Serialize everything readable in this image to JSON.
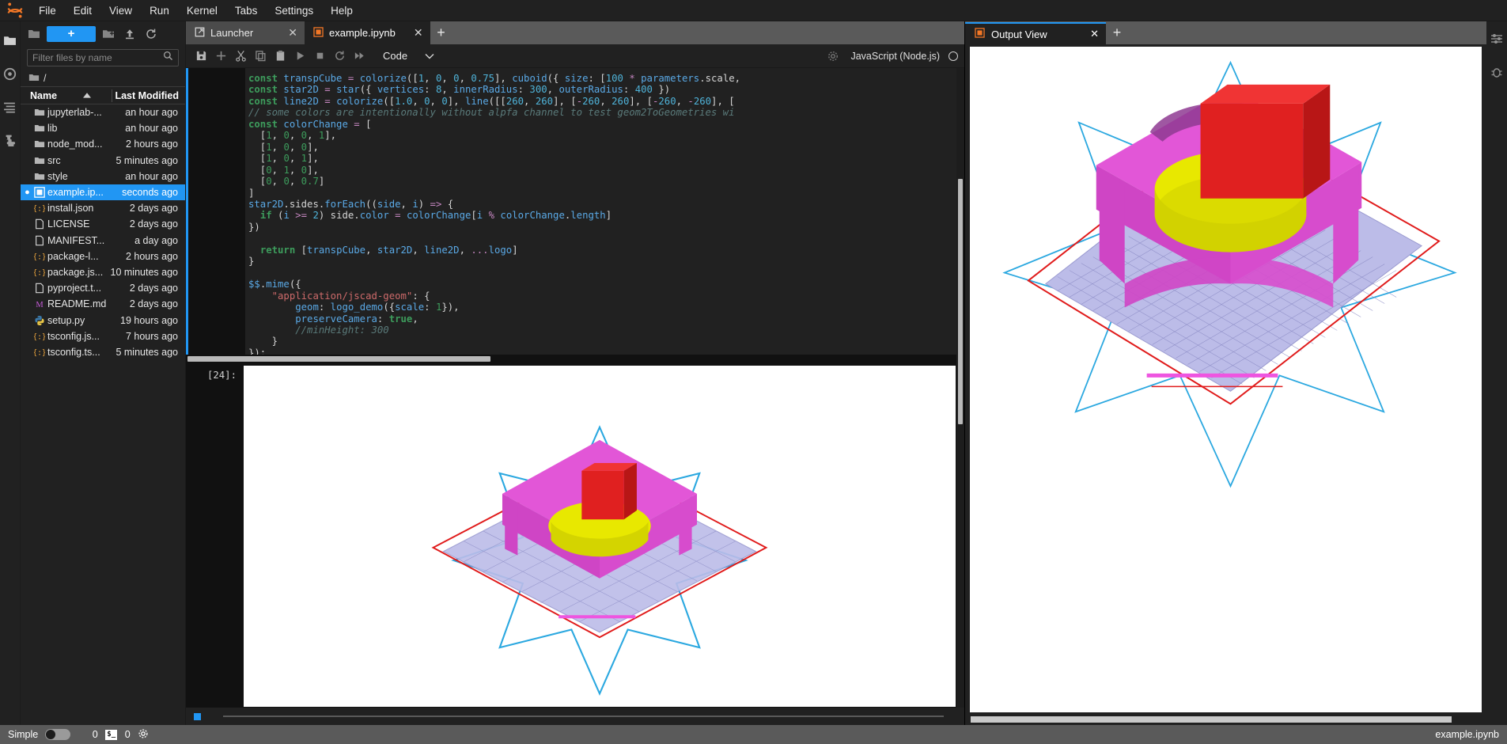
{
  "app": {
    "title": "JupyterLab",
    "logo_icon": "jupyter-logo-icon"
  },
  "menubar": {
    "items": [
      "File",
      "Edit",
      "View",
      "Run",
      "Kernel",
      "Tabs",
      "Settings",
      "Help"
    ]
  },
  "activity_bar": {
    "items": [
      {
        "name": "file-browser-icon",
        "glyph": "folder"
      },
      {
        "name": "running-terminals-icon",
        "glyph": "circle"
      },
      {
        "name": "table-of-contents-icon",
        "glyph": "list"
      },
      {
        "name": "extension-manager-icon",
        "glyph": "puzzle"
      }
    ]
  },
  "right_bar": {
    "items": [
      {
        "name": "property-inspector-icon",
        "glyph": "sliders"
      },
      {
        "name": "debugger-icon",
        "glyph": "bug"
      }
    ]
  },
  "file_browser": {
    "new_launcher_label": "+",
    "toolbar_icons": [
      "new-folder-icon",
      "upload-icon",
      "refresh-icon"
    ],
    "filter": {
      "placeholder": "Filter files by name",
      "value": ""
    },
    "breadcrumb": "/",
    "columns": {
      "name": "Name",
      "last_modified": "Last Modified",
      "sort_direction": "ascending"
    },
    "items": [
      {
        "name": "jupyterlab-...",
        "modified": "an hour ago",
        "kind": "folder",
        "selected": false,
        "dirty": false
      },
      {
        "name": "lib",
        "modified": "an hour ago",
        "kind": "folder",
        "selected": false,
        "dirty": false
      },
      {
        "name": "node_mod...",
        "modified": "2 hours ago",
        "kind": "folder",
        "selected": false,
        "dirty": false
      },
      {
        "name": "src",
        "modified": "5 minutes ago",
        "kind": "folder",
        "selected": false,
        "dirty": false
      },
      {
        "name": "style",
        "modified": "an hour ago",
        "kind": "folder",
        "selected": false,
        "dirty": false
      },
      {
        "name": "example.ip...",
        "modified": "seconds ago",
        "kind": "notebook",
        "selected": true,
        "dirty": true
      },
      {
        "name": "install.json",
        "modified": "2 days ago",
        "kind": "json",
        "selected": false,
        "dirty": false
      },
      {
        "name": "LICENSE",
        "modified": "2 days ago",
        "kind": "file",
        "selected": false,
        "dirty": false
      },
      {
        "name": "MANIFEST...",
        "modified": "a day ago",
        "kind": "file",
        "selected": false,
        "dirty": false
      },
      {
        "name": "package-l...",
        "modified": "2 hours ago",
        "kind": "json",
        "selected": false,
        "dirty": false
      },
      {
        "name": "package.js...",
        "modified": "10 minutes ago",
        "kind": "json",
        "selected": false,
        "dirty": false
      },
      {
        "name": "pyproject.t...",
        "modified": "2 days ago",
        "kind": "file",
        "selected": false,
        "dirty": false
      },
      {
        "name": "README.md",
        "modified": "2 days ago",
        "kind": "markdown",
        "selected": false,
        "dirty": false
      },
      {
        "name": "setup.py",
        "modified": "19 hours ago",
        "kind": "python",
        "selected": false,
        "dirty": false
      },
      {
        "name": "tsconfig.js...",
        "modified": "7 hours ago",
        "kind": "json",
        "selected": false,
        "dirty": false
      },
      {
        "name": "tsconfig.ts...",
        "modified": "5 minutes ago",
        "kind": "json",
        "selected": false,
        "dirty": false
      }
    ]
  },
  "main_dock": {
    "tabs": [
      {
        "label": "Launcher",
        "icon": "launcher-icon",
        "active": false,
        "close": "✕"
      },
      {
        "label": "example.ipynb",
        "icon": "notebook-icon",
        "active": true,
        "close": "✕"
      }
    ],
    "add_tab_label": "+"
  },
  "notebook_toolbar": {
    "buttons": [
      {
        "name": "save-button",
        "glyph": "save"
      },
      {
        "name": "insert-cell-button",
        "glyph": "plus"
      },
      {
        "name": "cut-cell-button",
        "glyph": "scissors"
      },
      {
        "name": "copy-cell-button",
        "glyph": "copy"
      },
      {
        "name": "paste-cell-button",
        "glyph": "paste"
      },
      {
        "name": "run-cell-button",
        "glyph": "play"
      },
      {
        "name": "stop-kernel-button",
        "glyph": "square"
      },
      {
        "name": "restart-kernel-button",
        "glyph": "restart"
      },
      {
        "name": "restart-run-all-button",
        "glyph": "fast-forward"
      }
    ],
    "cell_type": "Code",
    "cell_type_chevron": "∨",
    "settings_icon": "gear-icon",
    "kernel_name": "JavaScript (Node.js)",
    "kernel_status": "idle"
  },
  "notebook": {
    "input_prompt": "",
    "output_prompt": "[24]:",
    "code_lines": [
      [
        [
          "k",
          "const "
        ],
        [
          "v",
          "transpCube"
        ],
        [
          "w",
          " "
        ],
        [
          "p",
          "="
        ],
        [
          "w",
          " "
        ],
        [
          "v",
          "colorize"
        ],
        [
          "w",
          "(["
        ],
        [
          "n",
          "1"
        ],
        [
          "w",
          ", "
        ],
        [
          "n",
          "0"
        ],
        [
          "w",
          ", "
        ],
        [
          "n",
          "0"
        ],
        [
          "w",
          ", "
        ],
        [
          "n",
          "0.75"
        ],
        [
          "w",
          "], "
        ],
        [
          "v",
          "cuboid"
        ],
        [
          "w",
          "({ "
        ],
        [
          "v",
          "size"
        ],
        [
          "w",
          ": ["
        ],
        [
          "n",
          "100"
        ],
        [
          "w",
          " "
        ],
        [
          "p",
          "*"
        ],
        [
          "w",
          " "
        ],
        [
          "v",
          "parameters"
        ],
        [
          "w",
          ".scale,"
        ]
      ],
      [
        [
          "k",
          "const "
        ],
        [
          "v",
          "star2D"
        ],
        [
          "w",
          " "
        ],
        [
          "p",
          "="
        ],
        [
          "w",
          " "
        ],
        [
          "v",
          "star"
        ],
        [
          "w",
          "({ "
        ],
        [
          "v",
          "vertices"
        ],
        [
          "w",
          ": "
        ],
        [
          "n",
          "8"
        ],
        [
          "w",
          ", "
        ],
        [
          "v",
          "innerRadius"
        ],
        [
          "w",
          ": "
        ],
        [
          "n",
          "300"
        ],
        [
          "w",
          ", "
        ],
        [
          "v",
          "outerRadius"
        ],
        [
          "w",
          ": "
        ],
        [
          "n",
          "400"
        ],
        [
          "w",
          " })"
        ]
      ],
      [
        [
          "k",
          "const "
        ],
        [
          "v",
          "line2D"
        ],
        [
          "w",
          " "
        ],
        [
          "p",
          "="
        ],
        [
          "w",
          " "
        ],
        [
          "v",
          "colorize"
        ],
        [
          "w",
          "(["
        ],
        [
          "n",
          "1.0"
        ],
        [
          "w",
          ", "
        ],
        [
          "n",
          "0"
        ],
        [
          "w",
          ", "
        ],
        [
          "n",
          "0"
        ],
        [
          "w",
          "], "
        ],
        [
          "v",
          "line"
        ],
        [
          "w",
          "([["
        ],
        [
          "n",
          "260"
        ],
        [
          "w",
          ", "
        ],
        [
          "n",
          "260"
        ],
        [
          "w",
          "], ["
        ],
        [
          "p",
          "-"
        ],
        [
          "n",
          "260"
        ],
        [
          "w",
          ", "
        ],
        [
          "n",
          "260"
        ],
        [
          "w",
          "], ["
        ],
        [
          "p",
          "-"
        ],
        [
          "n",
          "260"
        ],
        [
          "w",
          ", "
        ],
        [
          "p",
          "-"
        ],
        [
          "n",
          "260"
        ],
        [
          "w",
          "], ["
        ]
      ],
      [
        [
          "c",
          "// some colors are intentionally without alpfa channel to test geom2ToGeometries wi"
        ]
      ],
      [
        [
          "k",
          "const "
        ],
        [
          "v",
          "colorChange"
        ],
        [
          "w",
          " "
        ],
        [
          "p",
          "="
        ],
        [
          "w",
          " ["
        ]
      ],
      [
        [
          "w",
          "  ["
        ],
        [
          "g",
          "1"
        ],
        [
          "w",
          ", "
        ],
        [
          "g",
          "0"
        ],
        [
          "w",
          ", "
        ],
        [
          "g",
          "0"
        ],
        [
          "w",
          ", "
        ],
        [
          "g",
          "1"
        ],
        [
          "w",
          "],"
        ]
      ],
      [
        [
          "w",
          "  ["
        ],
        [
          "g",
          "1"
        ],
        [
          "w",
          ", "
        ],
        [
          "g",
          "0"
        ],
        [
          "w",
          ", "
        ],
        [
          "g",
          "0"
        ],
        [
          "w",
          "],"
        ]
      ],
      [
        [
          "w",
          "  ["
        ],
        [
          "g",
          "1"
        ],
        [
          "w",
          ", "
        ],
        [
          "g",
          "0"
        ],
        [
          "w",
          ", "
        ],
        [
          "g",
          "1"
        ],
        [
          "w",
          "],"
        ]
      ],
      [
        [
          "w",
          "  ["
        ],
        [
          "g",
          "0"
        ],
        [
          "w",
          ", "
        ],
        [
          "g",
          "1"
        ],
        [
          "w",
          ", "
        ],
        [
          "g",
          "0"
        ],
        [
          "w",
          "],"
        ]
      ],
      [
        [
          "w",
          "  ["
        ],
        [
          "g",
          "0"
        ],
        [
          "w",
          ", "
        ],
        [
          "g",
          "0"
        ],
        [
          "w",
          ", "
        ],
        [
          "g",
          "0.7"
        ],
        [
          "w",
          "]"
        ]
      ],
      [
        [
          "w",
          "]"
        ]
      ],
      [
        [
          "v",
          "star2D"
        ],
        [
          "w",
          ".sides."
        ],
        [
          "v",
          "forEach"
        ],
        [
          "w",
          "(("
        ],
        [
          "v",
          "side"
        ],
        [
          "w",
          ", "
        ],
        [
          "v",
          "i"
        ],
        [
          "w",
          ") "
        ],
        [
          "p",
          "=>"
        ],
        [
          "w",
          " {"
        ]
      ],
      [
        [
          "w",
          "  "
        ],
        [
          "k",
          "if"
        ],
        [
          "w",
          " ("
        ],
        [
          "v",
          "i"
        ],
        [
          "w",
          " "
        ],
        [
          "p",
          ">="
        ],
        [
          "w",
          " "
        ],
        [
          "n",
          "2"
        ],
        [
          "w",
          ") side."
        ],
        [
          "v",
          "color"
        ],
        [
          "w",
          " "
        ],
        [
          "p",
          "="
        ],
        [
          "w",
          " "
        ],
        [
          "v",
          "colorChange"
        ],
        [
          "w",
          "["
        ],
        [
          "v",
          "i"
        ],
        [
          "w",
          " "
        ],
        [
          "p",
          "%"
        ],
        [
          "w",
          " "
        ],
        [
          "v",
          "colorChange"
        ],
        [
          "w",
          "."
        ],
        [
          "v",
          "length"
        ],
        [
          "w",
          "]"
        ]
      ],
      [
        [
          "w",
          "})"
        ]
      ],
      [
        [
          "w",
          ""
        ]
      ],
      [
        [
          "w",
          "  "
        ],
        [
          "k",
          "return"
        ],
        [
          "w",
          " ["
        ],
        [
          "v",
          "transpCube"
        ],
        [
          "w",
          ", "
        ],
        [
          "v",
          "star2D"
        ],
        [
          "w",
          ", "
        ],
        [
          "v",
          "line2D"
        ],
        [
          "w",
          ", "
        ],
        [
          "p",
          "..."
        ],
        [
          "v",
          "logo"
        ],
        [
          "w",
          "]"
        ]
      ],
      [
        [
          "w",
          "}"
        ]
      ],
      [
        [
          "w",
          ""
        ]
      ],
      [
        [
          "v",
          "$$"
        ],
        [
          "w",
          "."
        ],
        [
          "v",
          "mime"
        ],
        [
          "w",
          "({"
        ]
      ],
      [
        [
          "w",
          "    "
        ],
        [
          "s",
          "\"application/jscad-geom\""
        ],
        [
          "w",
          ": {"
        ]
      ],
      [
        [
          "w",
          "        "
        ],
        [
          "v",
          "geom"
        ],
        [
          "w",
          ": "
        ],
        [
          "v",
          "logo_demo"
        ],
        [
          "w",
          "({"
        ],
        [
          "v",
          "scale"
        ],
        [
          "w",
          ": "
        ],
        [
          "g",
          "1"
        ],
        [
          "w",
          "}),"
        ]
      ],
      [
        [
          "w",
          "        "
        ],
        [
          "v",
          "preserveCamera"
        ],
        [
          "w",
          ": "
        ],
        [
          "k",
          "true"
        ],
        [
          "w",
          ","
        ]
      ],
      [
        [
          "w",
          "        "
        ],
        [
          "c",
          "//minHeight: 300"
        ]
      ],
      [
        [
          "w",
          "    }"
        ]
      ],
      [
        [
          "w",
          "});"
        ]
      ]
    ]
  },
  "output_view": {
    "tabs": [
      {
        "label": "Output View",
        "icon": "notebook-icon",
        "active": true,
        "close": "✕"
      }
    ],
    "add_tab_label": "+",
    "render": {
      "description": "jscad 3D viewer: magenta extruded logo on lavender grid plate with red translucent cube, yellow arcs, cyan 8-point star outline and red line frame",
      "colors": {
        "magenta": "#e256d7",
        "magenta_dark": "#c23fb8",
        "yellow": "#e8e800",
        "red": "#e01b1b",
        "cube_red": "#e02020",
        "grid": "#b9b9e8",
        "star_outline": "#2ba8e0",
        "background": "#ffffff"
      }
    }
  },
  "status_bar": {
    "mode_label": "Simple",
    "mode_enabled": false,
    "kernel_count": "0",
    "terminal_icon": "terminal-icon",
    "terminal_count": "0",
    "settings_icon": "gear-icon",
    "active_document": "example.ipynb"
  }
}
